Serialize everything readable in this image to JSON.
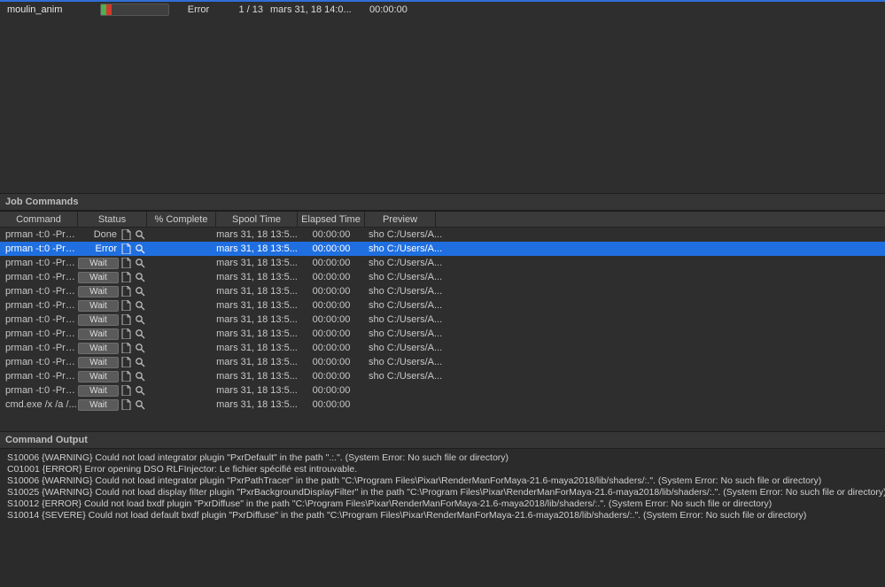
{
  "job": {
    "name": "moulin_anim",
    "status_label": "Error",
    "progress_text": "1 / 13",
    "spool_time": "mars 31, 18 14:0...",
    "elapsed": "00:00:00",
    "done_pct": 7.7,
    "err_pct": 7.7
  },
  "sections": {
    "commands": "Job Commands",
    "output": "Command Output"
  },
  "cmd_headers": {
    "command": "Command",
    "status": "Status",
    "pct": "% Complete",
    "spool": "Spool Time",
    "elapsed": "Elapsed Time",
    "preview": "Preview"
  },
  "status_labels": {
    "done": "Done",
    "error": "Error",
    "wait": "Wait"
  },
  "commands": [
    {
      "cmd": "prman -t:0 -Pro...",
      "status": "done",
      "selected": false,
      "spool": "mars 31, 18 13:5...",
      "elapsed": "00:00:00",
      "preview": "sho C:/Users/A..."
    },
    {
      "cmd": "prman -t:0 -Pro...",
      "status": "error",
      "selected": true,
      "spool": "mars 31, 18 13:5...",
      "elapsed": "00:00:00",
      "preview": "sho C:/Users/A..."
    },
    {
      "cmd": "prman -t:0 -Pro...",
      "status": "wait",
      "selected": false,
      "spool": "mars 31, 18 13:5...",
      "elapsed": "00:00:00",
      "preview": "sho C:/Users/A..."
    },
    {
      "cmd": "prman -t:0 -Pro...",
      "status": "wait",
      "selected": false,
      "spool": "mars 31, 18 13:5...",
      "elapsed": "00:00:00",
      "preview": "sho C:/Users/A..."
    },
    {
      "cmd": "prman -t:0 -Pro...",
      "status": "wait",
      "selected": false,
      "spool": "mars 31, 18 13:5...",
      "elapsed": "00:00:00",
      "preview": "sho C:/Users/A..."
    },
    {
      "cmd": "prman -t:0 -Pro...",
      "status": "wait",
      "selected": false,
      "spool": "mars 31, 18 13:5...",
      "elapsed": "00:00:00",
      "preview": "sho C:/Users/A..."
    },
    {
      "cmd": "prman -t:0 -Pro...",
      "status": "wait",
      "selected": false,
      "spool": "mars 31, 18 13:5...",
      "elapsed": "00:00:00",
      "preview": "sho C:/Users/A..."
    },
    {
      "cmd": "prman -t:0 -Pro...",
      "status": "wait",
      "selected": false,
      "spool": "mars 31, 18 13:5...",
      "elapsed": "00:00:00",
      "preview": "sho C:/Users/A..."
    },
    {
      "cmd": "prman -t:0 -Pro...",
      "status": "wait",
      "selected": false,
      "spool": "mars 31, 18 13:5...",
      "elapsed": "00:00:00",
      "preview": "sho C:/Users/A..."
    },
    {
      "cmd": "prman -t:0 -Pro...",
      "status": "wait",
      "selected": false,
      "spool": "mars 31, 18 13:5...",
      "elapsed": "00:00:00",
      "preview": "sho C:/Users/A..."
    },
    {
      "cmd": "prman -t:0 -Pro...",
      "status": "wait",
      "selected": false,
      "spool": "mars 31, 18 13:5...",
      "elapsed": "00:00:00",
      "preview": "sho C:/Users/A..."
    },
    {
      "cmd": "prman -t:0 -Pro...",
      "status": "wait",
      "selected": false,
      "spool": "mars 31, 18 13:5...",
      "elapsed": "00:00:00",
      "preview": ""
    },
    {
      "cmd": "cmd.exe /x /a /...",
      "status": "wait",
      "selected": false,
      "spool": "mars 31, 18 13:5...",
      "elapsed": "00:00:00",
      "preview": ""
    }
  ],
  "output": [
    "S10006 {WARNING} Could not load integrator plugin \"PxrDefault\" in the path \".:.\". (System Error: No such file or directory)",
    "C01001 {ERROR}   Error opening DSO RLFInjector: Le fichier spécifié est introuvable.",
    "S10006 {WARNING} Could not load integrator plugin \"PxrPathTracer\" in the path \"C:\\Program Files\\Pixar\\RenderManForMaya-21.6-maya2018/lib/shaders/:.\". (System Error: No such file or directory)",
    "S10025 {WARNING} Could not load display filter plugin \"PxrBackgroundDisplayFilter\" in the path \"C:\\Program Files\\Pixar\\RenderManForMaya-21.6-maya2018/lib/shaders/:.\". (System Error: No such file or directory)",
    "S10012 {ERROR}   Could not load bxdf plugin \"PxrDiffuse\" in the path \"C:\\Program Files\\Pixar\\RenderManForMaya-21.6-maya2018/lib/shaders/:.\". (System Error: No such file or directory)",
    "S10014 {SEVERE}  Could not load default bxdf plugin \"PxrDiffuse\" in the path \"C:\\Program Files\\Pixar\\RenderManForMaya-21.6-maya2018/lib/shaders/:.\". (System Error: No such file or directory)"
  ]
}
